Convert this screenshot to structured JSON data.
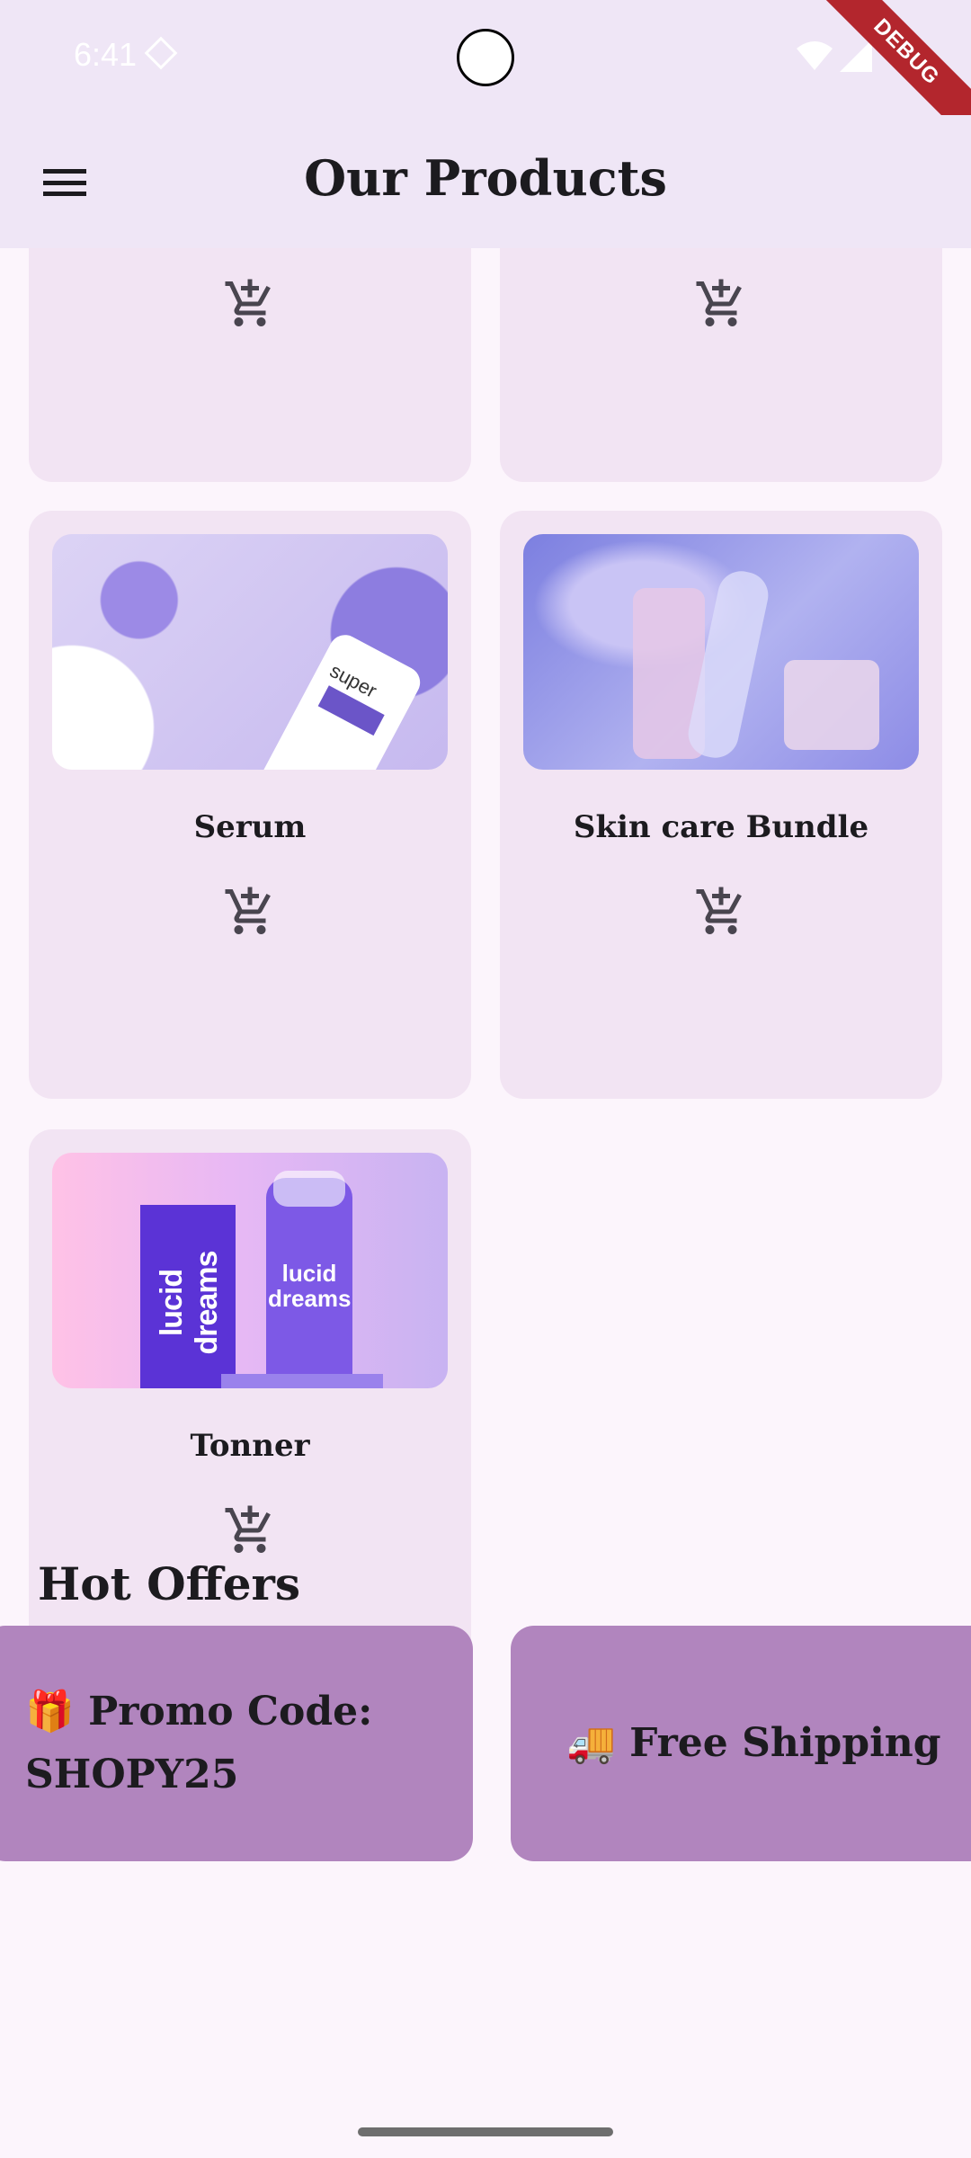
{
  "status_bar": {
    "time": "6:41",
    "debug_label": "DEBUG"
  },
  "app_bar": {
    "title": "Our Products"
  },
  "products": [
    {
      "name": "Serum"
    },
    {
      "name": "Skin care Bundle"
    },
    {
      "name": "Tonner"
    }
  ],
  "product_images": {
    "serum": {
      "bottle_text": "super"
    },
    "toner": {
      "box_text": "lucid dreams",
      "bottle_text": "lucid dreams"
    }
  },
  "hot_offers": {
    "title": "Hot Offers",
    "items": [
      {
        "icon": "🎁",
        "text": "Promo Code: SHOPY25"
      },
      {
        "icon": "🚚",
        "text": "Free Shipping"
      }
    ]
  },
  "colors": {
    "app_bar": "#efe6f6",
    "card": "#f2e4f3",
    "offer": "#b185be",
    "background": "#fcf5fc"
  }
}
